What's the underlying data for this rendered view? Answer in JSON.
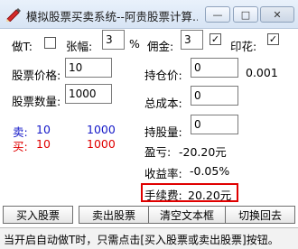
{
  "window": {
    "title": "模拟股票买卖系统--阿贵股票计算..."
  },
  "controls": {
    "maximize_glyph": "□",
    "close_glyph": "✕",
    "minimize_glyph": "—"
  },
  "top_row": {
    "t0_label": "做T:",
    "amplitude_label": "张幅:",
    "amplitude_value": "3",
    "percent_sign": "%",
    "commission_label": "佣金:",
    "commission_value": "3",
    "stamp_label": "印花:",
    "commission_checked": "✓",
    "stamp_checked": "✓"
  },
  "left": {
    "price_label": "股票价格:",
    "price_value": "10",
    "qty_label": "股票数量:",
    "qty_value": "1000",
    "sell_label": "卖:",
    "sell_price": "10",
    "sell_qty": "1000",
    "buy_label": "买:",
    "buy_price": "10",
    "buy_qty": "1000"
  },
  "right": {
    "hold_price_label": "持仓价:",
    "hold_price_value": "0",
    "hold_price_extra": "0.001",
    "total_cost_label": "总成本:",
    "total_cost_value": "0",
    "hold_qty_label": "持股量:",
    "hold_qty_value": "0",
    "profit_label": "盈亏:",
    "profit_value": "-20.20元",
    "yield_label": "收益率:",
    "yield_value": "-0.05%",
    "fee_label": "手续费:",
    "fee_value": "20.20元"
  },
  "buttons": {
    "buy": "买入股票",
    "sell": "卖出股票",
    "clear": "清空文本框",
    "switch": "切换回去"
  },
  "status": {
    "text": "当开启自动做T时，只需点击[买入股票或卖出股票]按钮。"
  },
  "colors": {
    "sell": "#1418c8",
    "buy": "#e00000",
    "highlight_border": "#e00000"
  }
}
